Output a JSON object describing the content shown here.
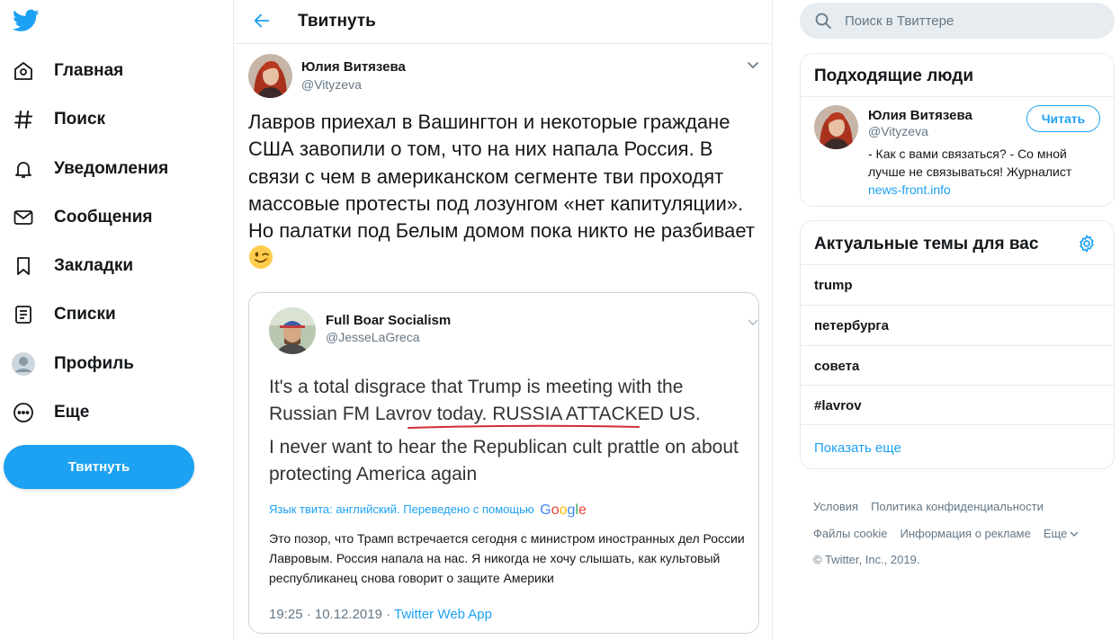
{
  "nav": {
    "items": [
      {
        "label": "Главная"
      },
      {
        "label": "Поиск"
      },
      {
        "label": "Уведомления"
      },
      {
        "label": "Сообщения"
      },
      {
        "label": "Закладки"
      },
      {
        "label": "Списки"
      },
      {
        "label": "Профиль"
      },
      {
        "label": "Еще"
      }
    ],
    "tweet_button": "Твитнуть"
  },
  "header": {
    "title": "Твитнуть"
  },
  "tweet": {
    "author_name": "Юлия Витязева",
    "author_handle": "@Vityzeva",
    "text": "Лавров приехал в Вашингтон и некоторые граждане США завопили о том, что на них напала Россия. В связи с чем в американском сегменте тви проходят массовые протесты под лозунгом «нет капитуляции». Но палатки  под Белым домом пока никто не разбивает",
    "emoji": "winking-face"
  },
  "quote": {
    "author_name": "Full Boar Socialism",
    "author_handle": "@JesseLaGreca",
    "text_before_underline": "It's a total disgrace that Trump is meeting with the Russian FM Lavrov today. ",
    "text_underlined": "RUSSIA ATTACKED US.",
    "text2": "I never want to hear the Republican cult prattle on about protecting America again",
    "translate_label": "Язык твита: английский. Переведено с помощью",
    "translate_brand": "Google",
    "translated_text": "Это позор, что Трамп встречается сегодня с министром иностранных дел России Лавровым. Россия напала на нас. Я никогда не хочу слышать, как культовый республиканец снова говорит о защите Америки",
    "timestamp": "19:25 · 10.12.2019 · ",
    "via": "Twitter Web App"
  },
  "search": {
    "placeholder": "Поиск в Твиттере"
  },
  "who_to_follow": {
    "title": "Подходящие люди",
    "name": "Юлия Витязева",
    "handle": "@Vityzeva",
    "follow_label": "Читать",
    "bio": "- Как с вами связаться? - Со мной лучше не связываться! Журналист ",
    "bio_link": "news-front.info"
  },
  "trends": {
    "title": "Актуальные темы для вас",
    "items": [
      "trump",
      "петербурга",
      "совета",
      "#lavrov"
    ],
    "show_more": "Показать еще"
  },
  "footer": {
    "links_row1": [
      "Условия",
      "Политика конфиденциальности"
    ],
    "links_row2": [
      "Файлы cookie",
      "Информация о рекламе",
      "Еще"
    ],
    "copyright": "© Twitter, Inc., 2019."
  },
  "colors": {
    "accent": "#1da1f2",
    "text": "#14171a",
    "secondary": "#657786",
    "border": "#e6ecf0"
  }
}
